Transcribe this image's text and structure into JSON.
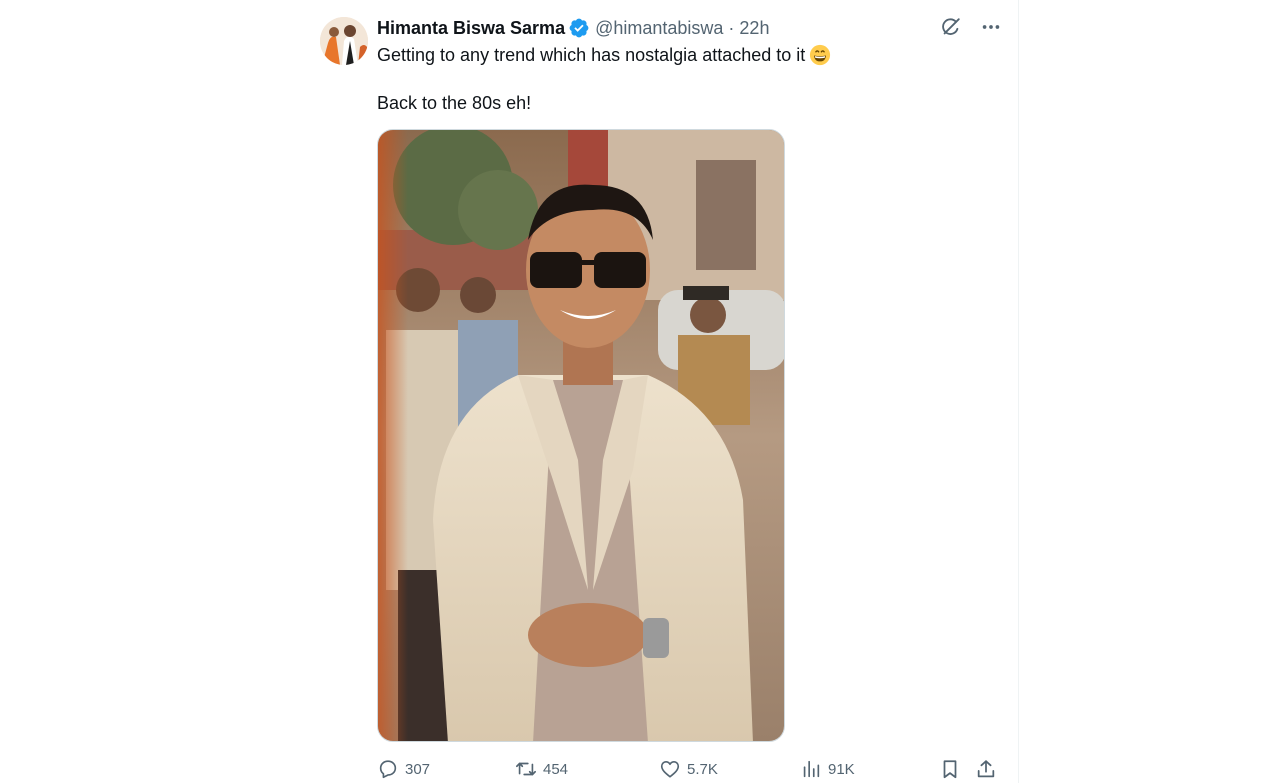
{
  "tweet": {
    "author": {
      "display_name": "Himanta Biswa Sarma",
      "verified": true,
      "handle": "@himantabiswa",
      "separator": "·",
      "time": "22h"
    },
    "text_lines": [
      "Getting to any trend which has nostalgia attached to it",
      "Back to the 80s eh!"
    ],
    "emoji": "grinning-face-emoji",
    "header_icons": [
      "grok-icon",
      "more-icon"
    ],
    "media": {
      "description_icon": "photo"
    },
    "actions": {
      "replies": "307",
      "reposts": "454",
      "likes": "5.7K",
      "views": "91K"
    }
  },
  "colors": {
    "text_primary": "#0f1419",
    "text_secondary": "#536471",
    "verified_blue": "#1d9bf0",
    "divider": "#eff3f4"
  }
}
